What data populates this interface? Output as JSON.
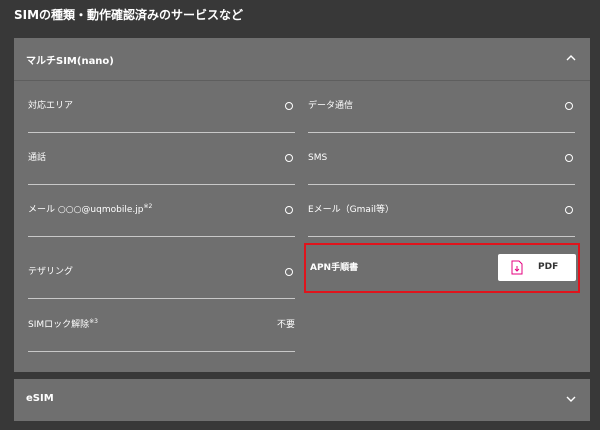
{
  "page": {
    "title": "SIMの種類・動作確認済みのサービスなど"
  },
  "multi_sim": {
    "title": "マルチSIM(nano)",
    "left_rows": [
      {
        "label": "対応エリア",
        "sup": "",
        "mark": "○"
      },
      {
        "label": "通話",
        "sup": "",
        "mark": "○"
      },
      {
        "label": "メール ○○○@uqmobile.jp",
        "sup": "※2",
        "mark": "○"
      },
      {
        "label": "テザリング",
        "sup": "",
        "mark": "○"
      },
      {
        "label": "SIMロック解除",
        "sup": "※3",
        "value": "不要"
      }
    ],
    "right_rows": [
      {
        "label": "データ通信",
        "mark": "○"
      },
      {
        "label": "SMS",
        "mark": "○"
      },
      {
        "label": "Eメール（Gmail等）",
        "mark": "○"
      }
    ],
    "apn": {
      "label": "APN手順書",
      "button_label": "PDF"
    }
  },
  "esim": {
    "title": "eSIM"
  },
  "colors": {
    "highlight": "#e0141c",
    "pdf_icon": "#e4007f"
  },
  "icons": {
    "collapse": "chevron-up-icon",
    "expand": "chevron-down-icon",
    "pdf": "pdf-download-icon"
  }
}
